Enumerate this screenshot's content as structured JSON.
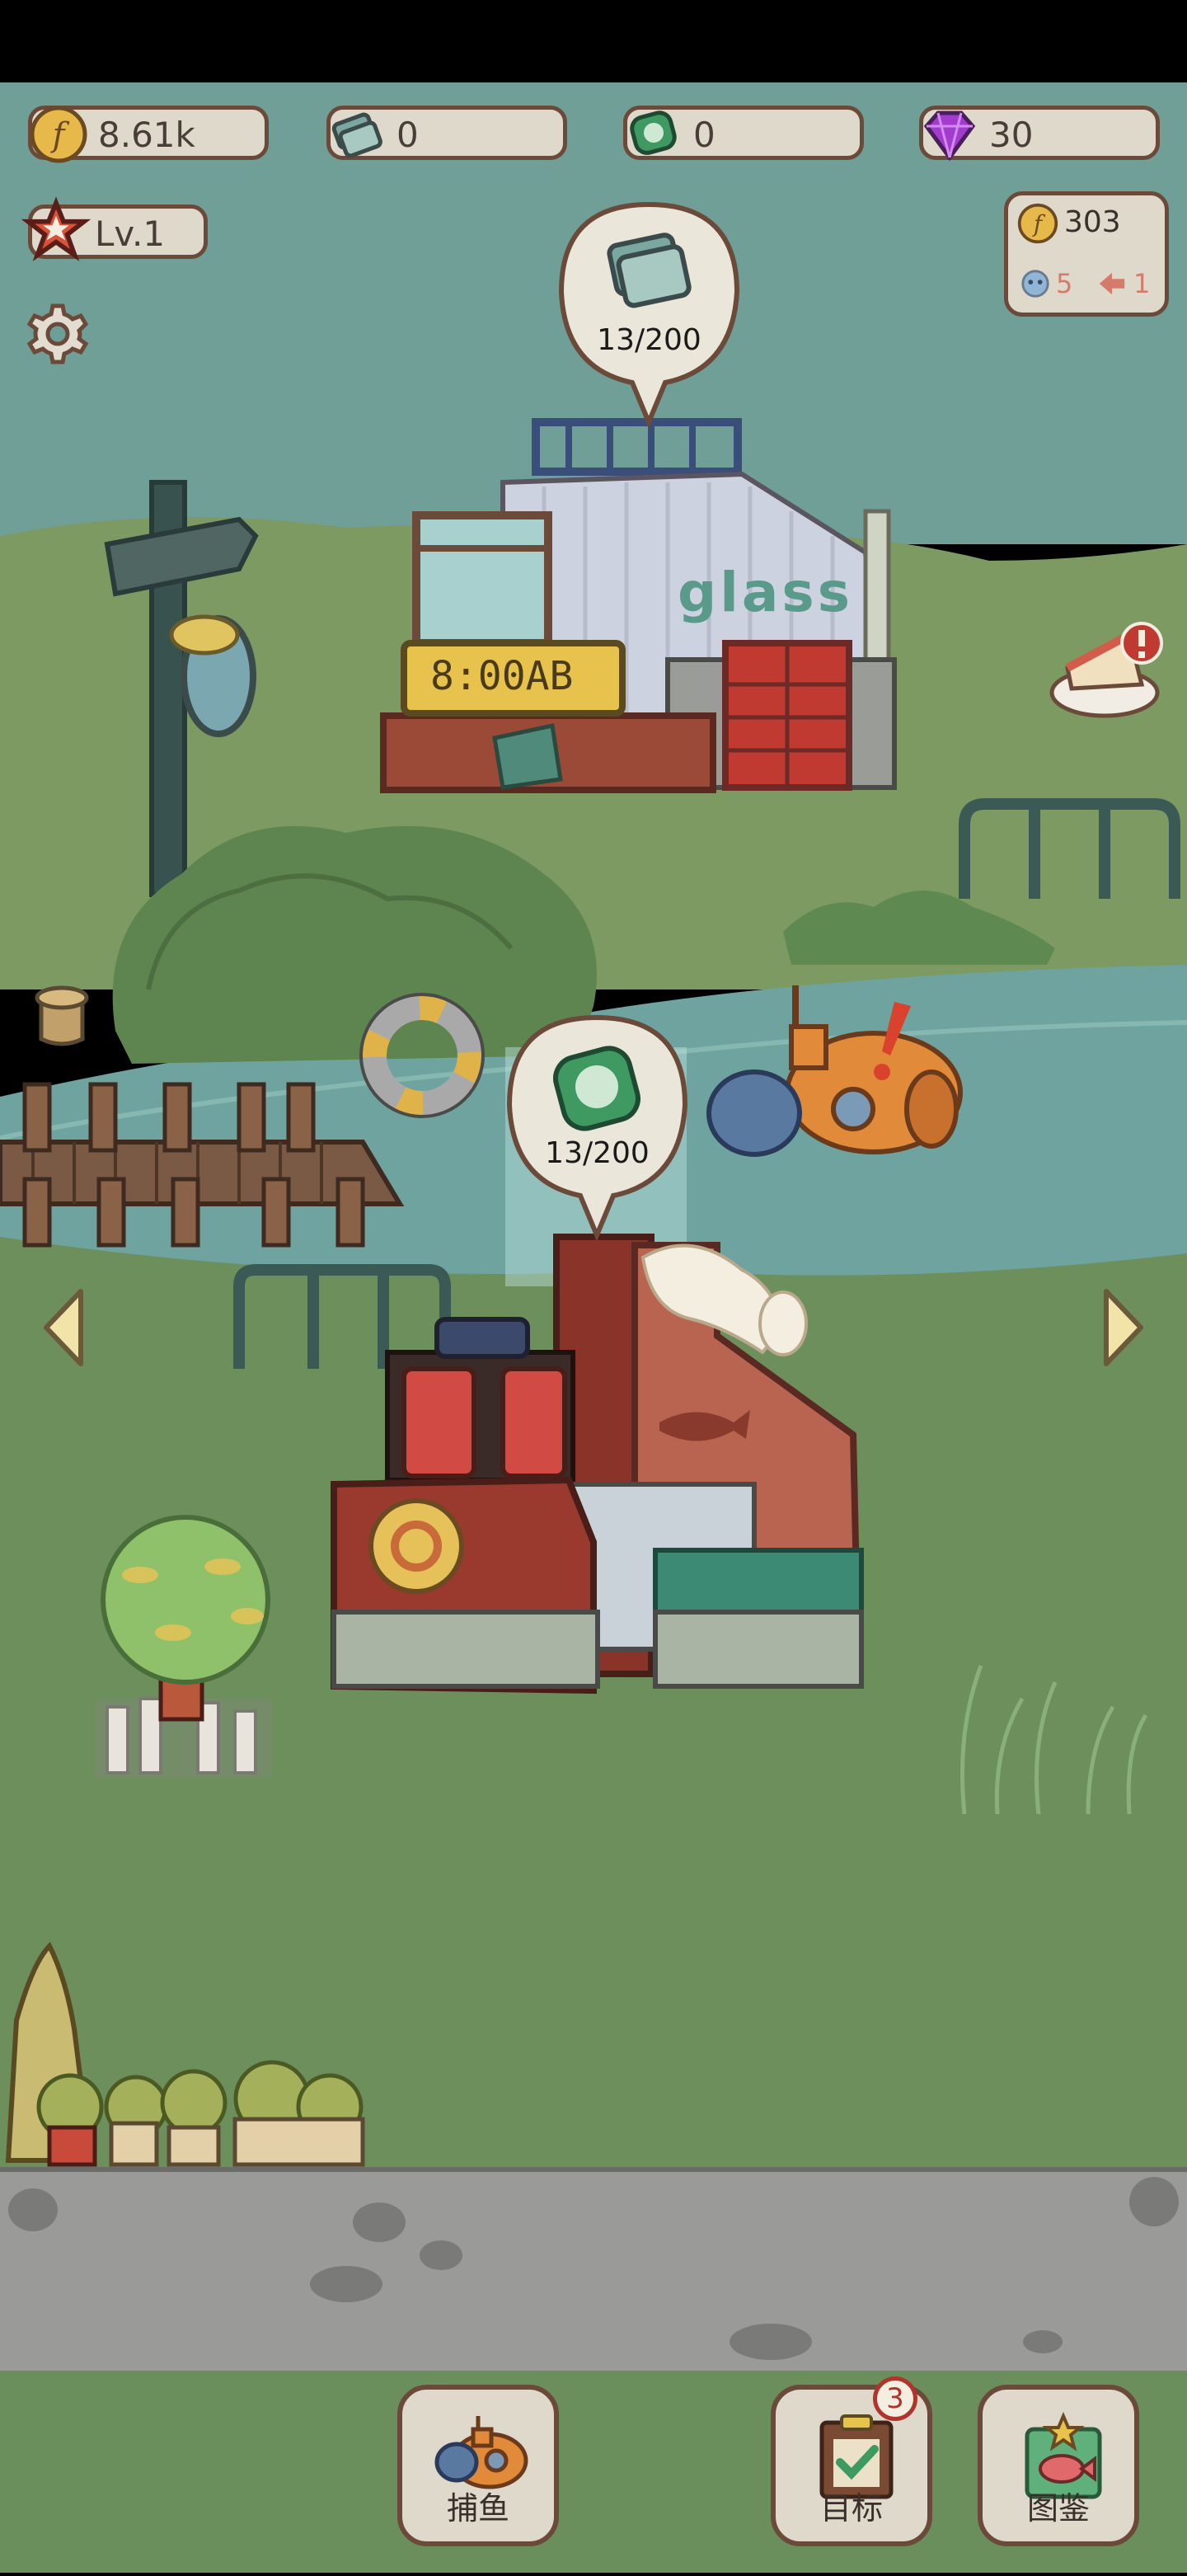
{
  "hud": {
    "coins": "8.61k",
    "glass": "0",
    "plastic": "0",
    "gems": "30",
    "level": "Lv.1"
  },
  "earnings_card": {
    "coins": "303",
    "fish_count": "5",
    "speed": "1"
  },
  "factory_glass": {
    "progress": "13/200",
    "sign_text": "glass",
    "clock_text": "8:00AB"
  },
  "factory_plastic": {
    "progress": "13/200"
  },
  "bottom_nav": {
    "fish_label": "捕鱼",
    "goals_label": "目标",
    "goals_badge": "3",
    "collection_label": "图鉴"
  },
  "colors": {
    "pill_bg": "#ded9cb",
    "pill_border": "#6b4a3a",
    "water": "#6e9f97",
    "grass": "#6b8e5a",
    "road": "#9a9a98"
  }
}
